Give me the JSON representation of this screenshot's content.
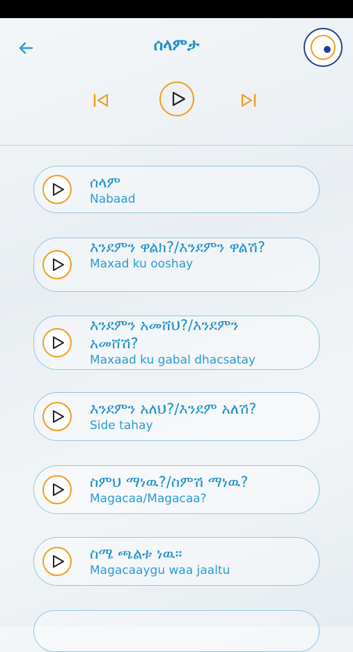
{
  "header": {
    "title": "ሰላምታ"
  },
  "phrases": [
    {
      "amharic": "ሰላም",
      "translation": "Nabaad"
    },
    {
      "amharic": "እንደምን ዋልክ?/እንደምን ዋልሽ?",
      "translation": "Maxad ku ooshay"
    },
    {
      "amharic": "እንደምን አመሸህ?/እንደምን አመሸሽ?",
      "translation": "Maxaad ku gabal dhacsatay"
    },
    {
      "amharic": "እንደምን አለህ?/እንደም አለሽ?",
      "translation": "Side tahay"
    },
    {
      "amharic": "ስምህ ማነዉ?/ስምሽ ማነዉ?",
      "translation": "Magacaa/Magacaa?"
    },
    {
      "amharic": "ስሜ ጫልቱ ነዉ።",
      "translation": "Magacaaygu waa jaaltu"
    }
  ],
  "colors": {
    "accent_blue": "#1d8fc8",
    "accent_orange": "#f29b1d",
    "border": "#8dc4e1"
  },
  "icons": [
    "back-arrow-icon",
    "skip-previous-icon",
    "play-icon",
    "skip-next-icon",
    "logo"
  ]
}
